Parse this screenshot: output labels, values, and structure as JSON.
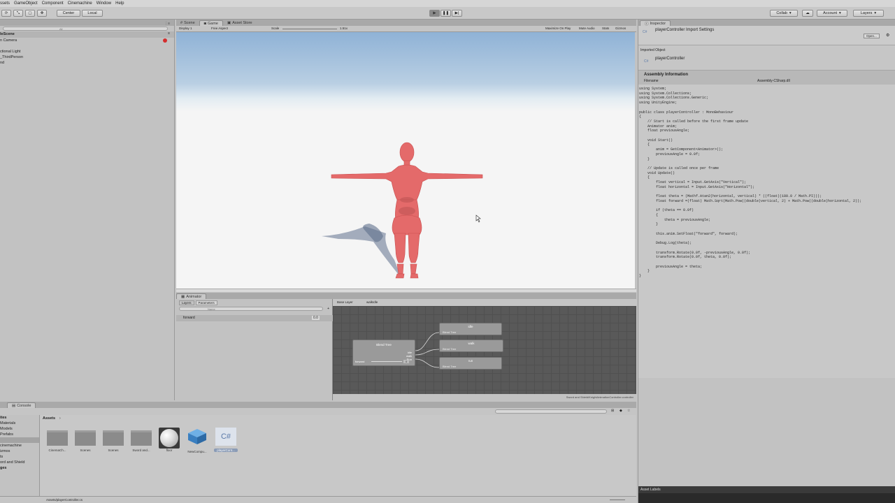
{
  "menubar": [
    "ssets",
    "GameObject",
    "Component",
    "Cinemachine",
    "Window",
    "Help"
  ],
  "toolbar": {
    "center": "Center",
    "local": "Local",
    "collab": "Collab",
    "account": "Account",
    "layers": "Layers"
  },
  "hierarchy": {
    "search_placeholder": "All",
    "scene": "leScene",
    "items": [
      "n Camera",
      "ctional Light",
      "_ThirdPerson",
      "nd"
    ]
  },
  "scene_tabs": [
    "Scene",
    "Game",
    "Asset Store"
  ],
  "game_bar": {
    "display": "Display 1",
    "aspect": "Free Aspect",
    "scale_label": "Scale",
    "scale_value": "1.51x",
    "maximize": "Maximize On Play",
    "mute": "Mute Audio",
    "stats": "Stats",
    "gizmos": "Gizmos"
  },
  "inspector": {
    "tab": "Inspector",
    "title": "playerController Import Settings",
    "open": "Open...",
    "imported_object": "Imported Object",
    "object_name": "playerController",
    "assembly_header": "Assembly Information",
    "filename_label": "Filename",
    "filename_value": "Assembly-CSharp.dll",
    "asset_labels": "Asset Labels",
    "code": "using System;\nusing System.Collections;\nusing System.Collections.Generic;\nusing UnityEngine;\n\npublic class playerController : MonoBehaviour\n{\n    // Start is called before the first frame update\n    Animator anim;\n    float previousAngle;\n\n    void Start()\n    {\n        anim = GetComponent<Animator>();\n        previousAngle = 0.0f;\n    }\n\n    // Update is called once per frame\n    void Update()\n    {\n        float vertical = Input.GetAxis(\"Vertical\");\n        float horizontal = Input.GetAxis(\"Horizontal\");\n\n        float theta = (Mathf.Atan2(horizontal, vertical) * ((float)(180.0 / Math.PI)));\n        float forward =(float) Math.Sqrt(Math.Pow((double)vertical, 2) + Math.Pow((double)horizontal, 2));\n\n        if (theta == 0.0f)\n        {\n            theta = previousAngle;\n        }\n\n        this.anim.SetFloat(\"forward\", forward);\n\n        Debug.Log(theta);\n\n        transform.Rotate(0.0f, -previousAngle, 0.0f);\n        transform.Rotate(0.0f, theta, 0.0f);\n\n        previousAngle = theta;\n    }\n}"
  },
  "animator": {
    "tab": "Animator",
    "layers": "Layers",
    "parameters": "Parameters",
    "search_placeholder": "Name",
    "param_name": "forward",
    "param_value": "0.0",
    "breadcrumb_base": "Base Layer",
    "breadcrumb_state": "walkIdle",
    "blend_tree": "Blend Tree",
    "blend_inputs": [
      "idle",
      "walk",
      "Run"
    ],
    "blend_param": "forward",
    "blend_value": "0",
    "children": [
      {
        "name": "idle",
        "sub": "Blend Tree"
      },
      {
        "name": "walk",
        "sub": "Blend Tree"
      },
      {
        "name": "run",
        "sub": "Blend Tree"
      }
    ],
    "status_path": "Sword and Shield/KnightAnimationController.controller"
  },
  "console": {
    "tab": "Console",
    "folders": [
      "ites",
      "Materials",
      "Models",
      "Prefabs",
      "",
      "enes",
      "cinemachine",
      "izmos",
      "ts",
      "ord and Shield",
      "ges"
    ],
    "assets_crumb": "Assets",
    "assets": [
      {
        "name": "CinemaCh...",
        "kind": "folder"
      },
      {
        "name": "Scenes",
        "kind": "folder"
      },
      {
        "name": "Scenes",
        "kind": "folder"
      },
      {
        "name": "Sword and...",
        "kind": "folder"
      },
      {
        "name": "floor",
        "kind": "material"
      },
      {
        "name": "NewCompu...",
        "kind": "prefab"
      },
      {
        "name": "playerCont...",
        "kind": "script"
      }
    ],
    "status_path": "Assets/playerController.cs"
  },
  "colors": {
    "character": "#e46a6a",
    "accent_select": "#3d6fb3",
    "node_gray": "#9a9a9a",
    "animator_bg": "#595959"
  }
}
